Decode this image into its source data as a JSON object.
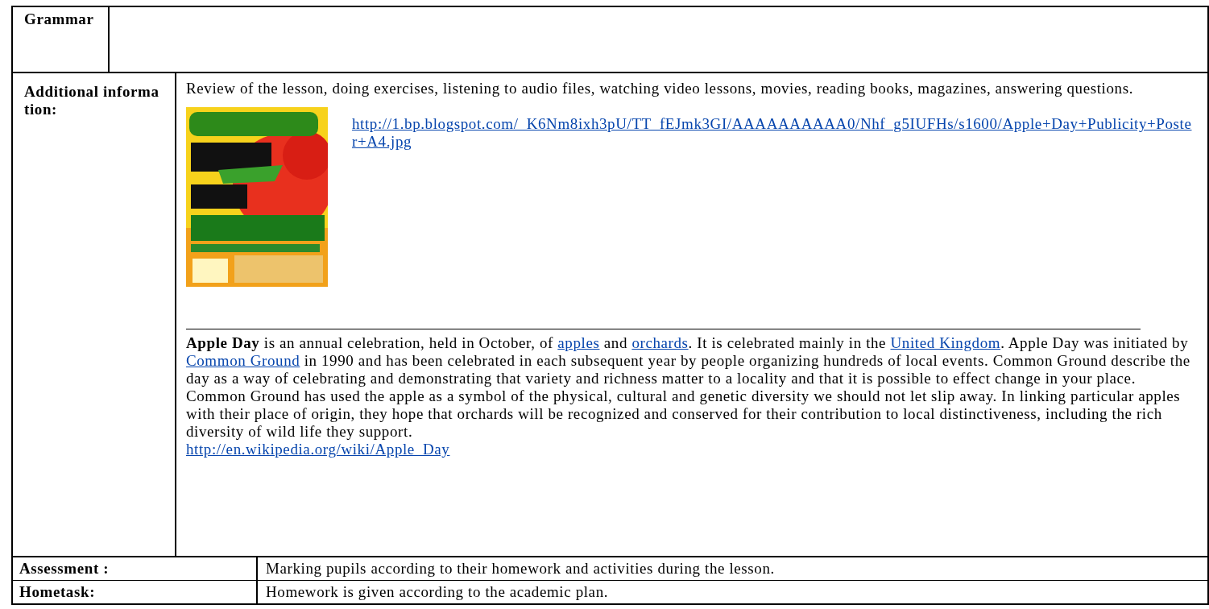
{
  "grammar_row": {
    "label": "Grammar"
  },
  "additional_row": {
    "label": "Additional information:",
    "intro": "Review of the lesson, doing exercises, listening to audio files, watching video lessons, movies, reading books, magazines, answering questions.",
    "poster_link": "http://1.bp.blogspot.com/_K6Nm8ixh3pU/TT_fEJmk3GI/AAAAAAAAAA0/Nhf_g5IUFHs/s1600/Apple+Day+Publicity+Poster+A4.jpg",
    "paragraph": [
      {
        "kind": "bold",
        "text": "Apple Day"
      },
      {
        "kind": "text",
        "text": " is an annual celebration, held in October, of "
      },
      {
        "kind": "link",
        "text": "apples"
      },
      {
        "kind": "text",
        "text": " and "
      },
      {
        "kind": "link",
        "text": "orchards"
      },
      {
        "kind": "text",
        "text": ". It is celebrated mainly in the "
      },
      {
        "kind": "link",
        "text": "United Kingdom"
      },
      {
        "kind": "text",
        "text": ". Apple Day was initiated by "
      },
      {
        "kind": "link",
        "text": "Common Ground"
      },
      {
        "kind": "text",
        "text": " in 1990 and has been celebrated in each subsequent year by people organizing hundreds of local events. Common Ground describe the day as a way of celebrating and demonstrating that variety and richness matter to a locality and that it is possible to effect change in your place. Common Ground has used the apple as a symbol of the physical, cultural and genetic diversity we should not let slip away. In linking particular apples with their place of origin, they hope that orchards will be recognized and conserved for their contribution to local distinctiveness, including the rich diversity of wild life they support."
      }
    ],
    "source_link": "http://en.wikipedia.org/wiki/Apple_Day"
  },
  "rows": [
    {
      "label": "Assessment :",
      "value": "Marking pupils according to their homework and activities during the lesson."
    },
    {
      "label": "Hometask:",
      "value": "Homework is given according to the academic plan."
    }
  ]
}
